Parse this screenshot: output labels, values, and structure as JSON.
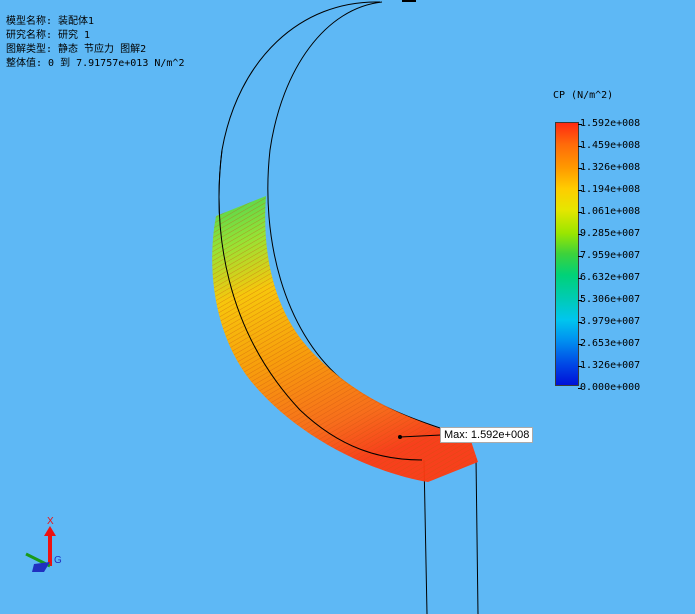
{
  "info": {
    "model_name": "模型名称: 装配体1",
    "study_name": "研究名称: 研究 1",
    "plot_type": "图解类型: 静态 节应力 图解2",
    "range": "整体值: 0 到 7.91757e+013 N/m^2"
  },
  "legend": {
    "title": "CP (N/m^2)",
    "ticks": [
      "1.592e+008",
      "1.459e+008",
      "1.326e+008",
      "1.194e+008",
      "1.061e+008",
      "9.285e+007",
      "7.959e+007",
      "6.632e+007",
      "5.306e+007",
      "3.979e+007",
      "2.653e+007",
      "1.326e+007",
      "0.000e+000"
    ]
  },
  "max_label": "Max: 1.592e+008",
  "triad": {
    "x_label": "X",
    "g_label": "G"
  },
  "colors": {
    "background": "#5eb8f5",
    "max": "#ff2a12",
    "min": "#0010d8"
  }
}
